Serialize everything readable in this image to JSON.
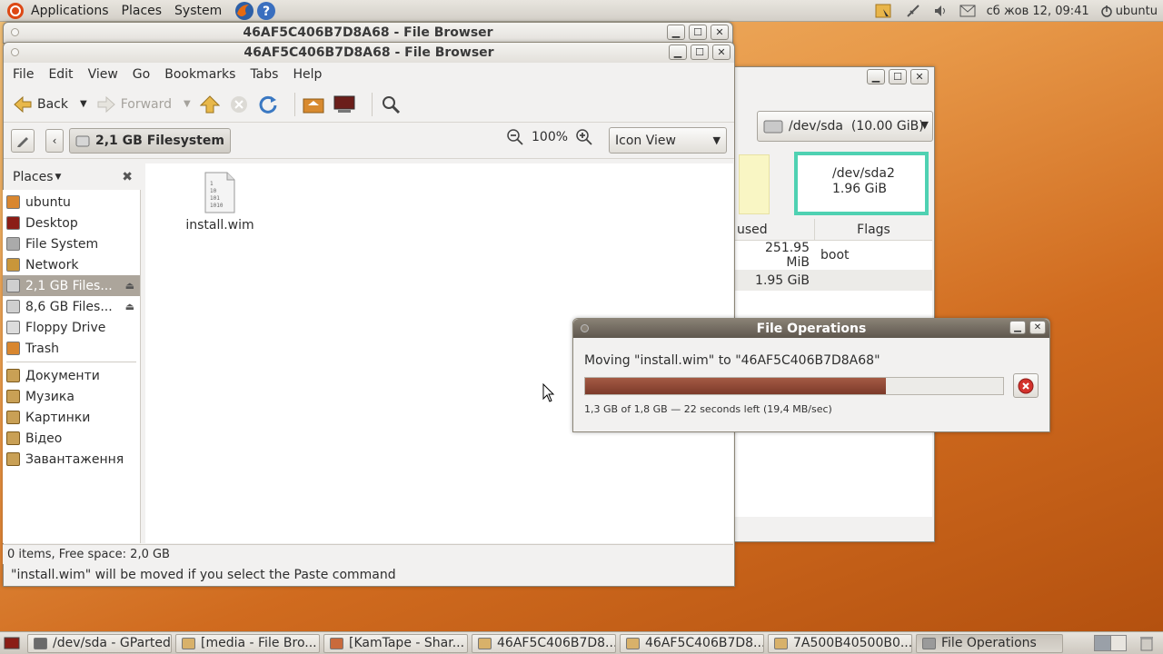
{
  "top_panel": {
    "menus": [
      "Applications",
      "Places",
      "System"
    ],
    "clock": "сб жов 12, 09:41",
    "user": "ubuntu"
  },
  "bg_window": {
    "title": "46AF5C406B7D8A68 - File Browser"
  },
  "file_browser": {
    "title": "46AF5C406B7D8A68 - File Browser",
    "menu": [
      "File",
      "Edit",
      "View",
      "Go",
      "Bookmarks",
      "Tabs",
      "Help"
    ],
    "toolbar": {
      "back": "Back",
      "forward": "Forward"
    },
    "location": "2,1 GB Filesystem",
    "zoom": "100%",
    "view_mode": "Icon View",
    "places_label": "Places",
    "places": [
      {
        "label": "ubuntu",
        "icon": "home-icon",
        "color": "#d8862f"
      },
      {
        "label": "Desktop",
        "icon": "desktop-icon",
        "color": "#8b1d16"
      },
      {
        "label": "File System",
        "icon": "filesystem-icon",
        "color": "#aaaaaa"
      },
      {
        "label": "Network",
        "icon": "network-icon",
        "color": "#c9963a"
      },
      {
        "label": "2,1 GB Files...",
        "icon": "drive-icon",
        "color": "#cfcfcf",
        "selected": true,
        "eject": true
      },
      {
        "label": "8,6 GB Files...",
        "icon": "drive-icon",
        "color": "#cfcfcf",
        "eject": true
      },
      {
        "label": "Floppy Drive",
        "icon": "floppy-icon",
        "color": "#dcdcdc"
      },
      {
        "label": "Trash",
        "icon": "trash-icon",
        "color": "#d8862f"
      }
    ],
    "bookmarks": [
      {
        "label": "Документи",
        "icon": "folder-icon"
      },
      {
        "label": "Музика",
        "icon": "folder-icon"
      },
      {
        "label": "Картинки",
        "icon": "folder-icon"
      },
      {
        "label": "Відео",
        "icon": "folder-icon"
      },
      {
        "label": "Завантаження",
        "icon": "folder-icon"
      }
    ],
    "files": [
      {
        "name": "install.wim",
        "icon": "binary-file-icon"
      }
    ],
    "status": "0 items, Free space: 2,0 GB",
    "hint": "\"install.wim\" will be moved if you select the Paste command"
  },
  "gparted": {
    "device": "/dev/sda  (10.00 GiB)",
    "partition_label": "/dev/sda2",
    "partition_size": "1.96 GiB",
    "columns": [
      "used",
      "Flags"
    ],
    "rows": [
      {
        "used": "251.95 MiB",
        "flags": "boot"
      },
      {
        "used": "1.95 GiB",
        "flags": ""
      }
    ]
  },
  "file_operations": {
    "title": "File Operations",
    "message": "Moving \"install.wim\" to \"46AF5C406B7D8A68\"",
    "progress": 0.72,
    "detail": "1,3 GB of 1,8 GB — 22 seconds left (19,4 MB/sec)"
  },
  "taskbar": [
    {
      "label": "/dev/sda - GParted",
      "active": false,
      "color": "#6a6a6a"
    },
    {
      "label": "[media - File Bro...",
      "active": false,
      "color": "#d8b16a"
    },
    {
      "label": "[KamTape - Shar...",
      "active": false,
      "color": "#c96a3c"
    },
    {
      "label": "46AF5C406B7D8...",
      "active": false,
      "color": "#d8b16a"
    },
    {
      "label": "46AF5C406B7D8...",
      "active": false,
      "color": "#d8b16a"
    },
    {
      "label": "7A500B40500B0...",
      "active": false,
      "color": "#d8b16a"
    },
    {
      "label": "File Operations",
      "active": true,
      "color": "#9a9a9a"
    }
  ]
}
